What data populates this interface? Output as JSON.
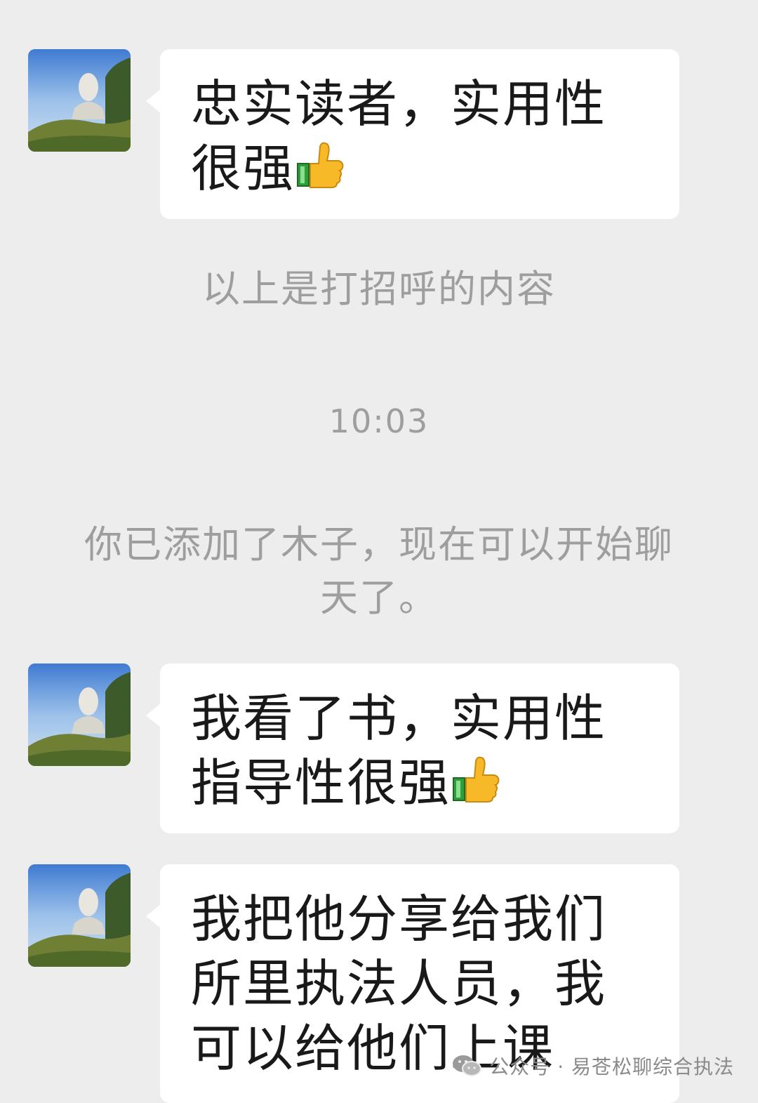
{
  "messages": [
    {
      "text": "忠实读者，实用性很强",
      "emoji": "thumbs-up"
    },
    {
      "text": "我看了书，实用性指导性很强",
      "emoji": "thumbs-up"
    },
    {
      "text": "我把他分享给我们所里执法人员，我可以给他们上课",
      "emoji": ""
    }
  ],
  "system": {
    "greeting_note": "以上是打招呼的内容",
    "timestamp": "10:03",
    "added_notice": "你已添加了木子，现在可以开始聊天了。"
  },
  "watermark": {
    "icon": "wechat-icon",
    "text": "公众号 · 易苍松聊综合执法"
  },
  "colors": {
    "background": "#ededed",
    "bubble": "#ffffff",
    "system_text": "#9e9e9e"
  }
}
